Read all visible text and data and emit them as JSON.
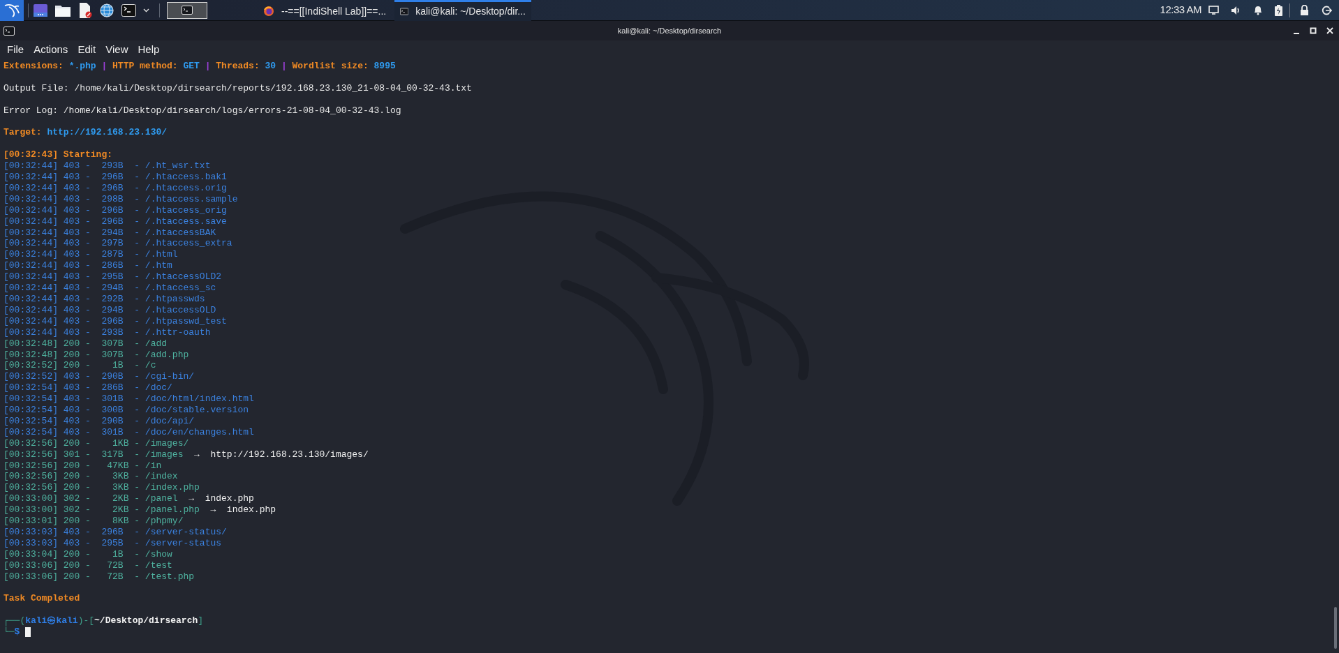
{
  "taskbar": {
    "launchers": [
      {
        "kind": "desktop"
      },
      {
        "kind": "folder"
      },
      {
        "kind": "editor"
      },
      {
        "kind": "browser"
      },
      {
        "kind": "terminal"
      }
    ],
    "workspaces": [
      {
        "selected": true
      }
    ],
    "tasks": [
      {
        "kind": "browser",
        "title": "--==[[IndiShell Lab]]==...",
        "selected": false
      },
      {
        "kind": "terminal",
        "title": "kali@kali: ~/Desktop/dir...",
        "selected": true
      }
    ],
    "clock": "12:33 AM"
  },
  "window": {
    "title": "kali@kali: ~/Desktop/dirsearch"
  },
  "menu": [
    "File",
    "Actions",
    "Edit",
    "View",
    "Help"
  ],
  "terminal": {
    "summary": {
      "separator": "|",
      "fields": [
        {
          "label": "Extensions:",
          "value": "*.php"
        },
        {
          "label": "HTTP method:",
          "value": "GET"
        },
        {
          "label": "Threads:",
          "value": "30"
        },
        {
          "label": "Wordlist size:",
          "value": "8995"
        }
      ]
    },
    "output_file": "Output File: /home/kali/Desktop/dirsearch/reports/192.168.23.130_21-08-04_00-32-43.txt",
    "error_log": "Error Log: /home/kali/Desktop/dirsearch/logs/errors-21-08-04_00-32-43.log",
    "target": {
      "label": "Target:",
      "value": "http://192.168.23.130/"
    },
    "starting": "[00:32:43] Starting:",
    "entries": [
      {
        "text": "[00:32:44] 403 -  293B  - /.ht_wsr.txt",
        "color": "#3b82e0"
      },
      {
        "text": "[00:32:44] 403 -  296B  - /.htaccess.bak1",
        "color": "#3b82e0"
      },
      {
        "text": "[00:32:44] 403 -  296B  - /.htaccess.orig",
        "color": "#3b82e0"
      },
      {
        "text": "[00:32:44] 403 -  298B  - /.htaccess.sample",
        "color": "#3b82e0"
      },
      {
        "text": "[00:32:44] 403 -  296B  - /.htaccess_orig",
        "color": "#3b82e0"
      },
      {
        "text": "[00:32:44] 403 -  296B  - /.htaccess.save",
        "color": "#3b82e0"
      },
      {
        "text": "[00:32:44] 403 -  294B  - /.htaccessBAK",
        "color": "#3b82e0"
      },
      {
        "text": "[00:32:44] 403 -  297B  - /.htaccess_extra",
        "color": "#3b82e0"
      },
      {
        "text": "[00:32:44] 403 -  287B  - /.html",
        "color": "#3b82e0"
      },
      {
        "text": "[00:32:44] 403 -  286B  - /.htm",
        "color": "#3b82e0"
      },
      {
        "text": "[00:32:44] 403 -  295B  - /.htaccessOLD2",
        "color": "#3b82e0"
      },
      {
        "text": "[00:32:44] 403 -  294B  - /.htaccess_sc",
        "color": "#3b82e0"
      },
      {
        "text": "[00:32:44] 403 -  292B  - /.htpasswds",
        "color": "#3b82e0"
      },
      {
        "text": "[00:32:44] 403 -  294B  - /.htaccessOLD",
        "color": "#3b82e0"
      },
      {
        "text": "[00:32:44] 403 -  296B  - /.htpasswd_test",
        "color": "#3b82e0"
      },
      {
        "text": "[00:32:44] 403 -  293B  - /.httr-oauth",
        "color": "#3b82e0"
      },
      {
        "text": "[00:32:48] 200 -  307B  - /add",
        "color": "#4fb3a0"
      },
      {
        "text": "[00:32:48] 200 -  307B  - /add.php",
        "color": "#4fb3a0"
      },
      {
        "text": "[00:32:52] 200 -    1B  - /c",
        "color": "#4fb3a0"
      },
      {
        "text": "[00:32:52] 403 -  290B  - /cgi-bin/",
        "color": "#3b82e0"
      },
      {
        "text": "[00:32:54] 403 -  286B  - /doc/",
        "color": "#3b82e0"
      },
      {
        "text": "[00:32:54] 403 -  301B  - /doc/html/index.html",
        "color": "#3b82e0"
      },
      {
        "text": "[00:32:54] 403 -  300B  - /doc/stable.version",
        "color": "#3b82e0"
      },
      {
        "text": "[00:32:54] 403 -  290B  - /doc/api/",
        "color": "#3b82e0"
      },
      {
        "text": "[00:32:54] 403 -  301B  - /doc/en/changes.html",
        "color": "#3b82e0"
      },
      {
        "text": "[00:32:56] 200 -    1KB - /images/",
        "color": "#4fb3a0"
      },
      {
        "text": "[00:32:56] 301 -  317B  - /images",
        "color": "#4fb3a0",
        "arrow": "→",
        "redirect": "http://192.168.23.130/images/"
      },
      {
        "text": "[00:32:56] 200 -   47KB - /in",
        "color": "#4fb3a0"
      },
      {
        "text": "[00:32:56] 200 -    3KB - /index",
        "color": "#4fb3a0"
      },
      {
        "text": "[00:32:56] 200 -    3KB - /index.php",
        "color": "#4fb3a0"
      },
      {
        "text": "[00:33:00] 302 -    2KB - /panel",
        "color": "#4fb3a0",
        "arrow": "→",
        "redirect": "index.php"
      },
      {
        "text": "[00:33:00] 302 -    2KB - /panel.php",
        "color": "#4fb3a0",
        "arrow": "→",
        "redirect": "index.php"
      },
      {
        "text": "[00:33:01] 200 -    8KB - /phpmy/",
        "color": "#4fb3a0"
      },
      {
        "text": "[00:33:03] 403 -  296B  - /server-status/",
        "color": "#3b82e0"
      },
      {
        "text": "[00:33:03] 403 -  295B  - /server-status",
        "color": "#3b82e0"
      },
      {
        "text": "[00:33:04] 200 -    1B  - /show",
        "color": "#4fb3a0"
      },
      {
        "text": "[00:33:06] 200 -   72B  - /test",
        "color": "#4fb3a0"
      },
      {
        "text": "[00:33:06] 200 -   72B  - /test.php",
        "color": "#4fb3a0"
      }
    ],
    "completion": "Task Completed",
    "prompt": {
      "open": "┌──(",
      "user": "kali㉿kali",
      "middle": ")-[",
      "path": "~/Desktop/dirsearch",
      "close": "]",
      "bottom": "└─",
      "symbol": "$"
    }
  }
}
